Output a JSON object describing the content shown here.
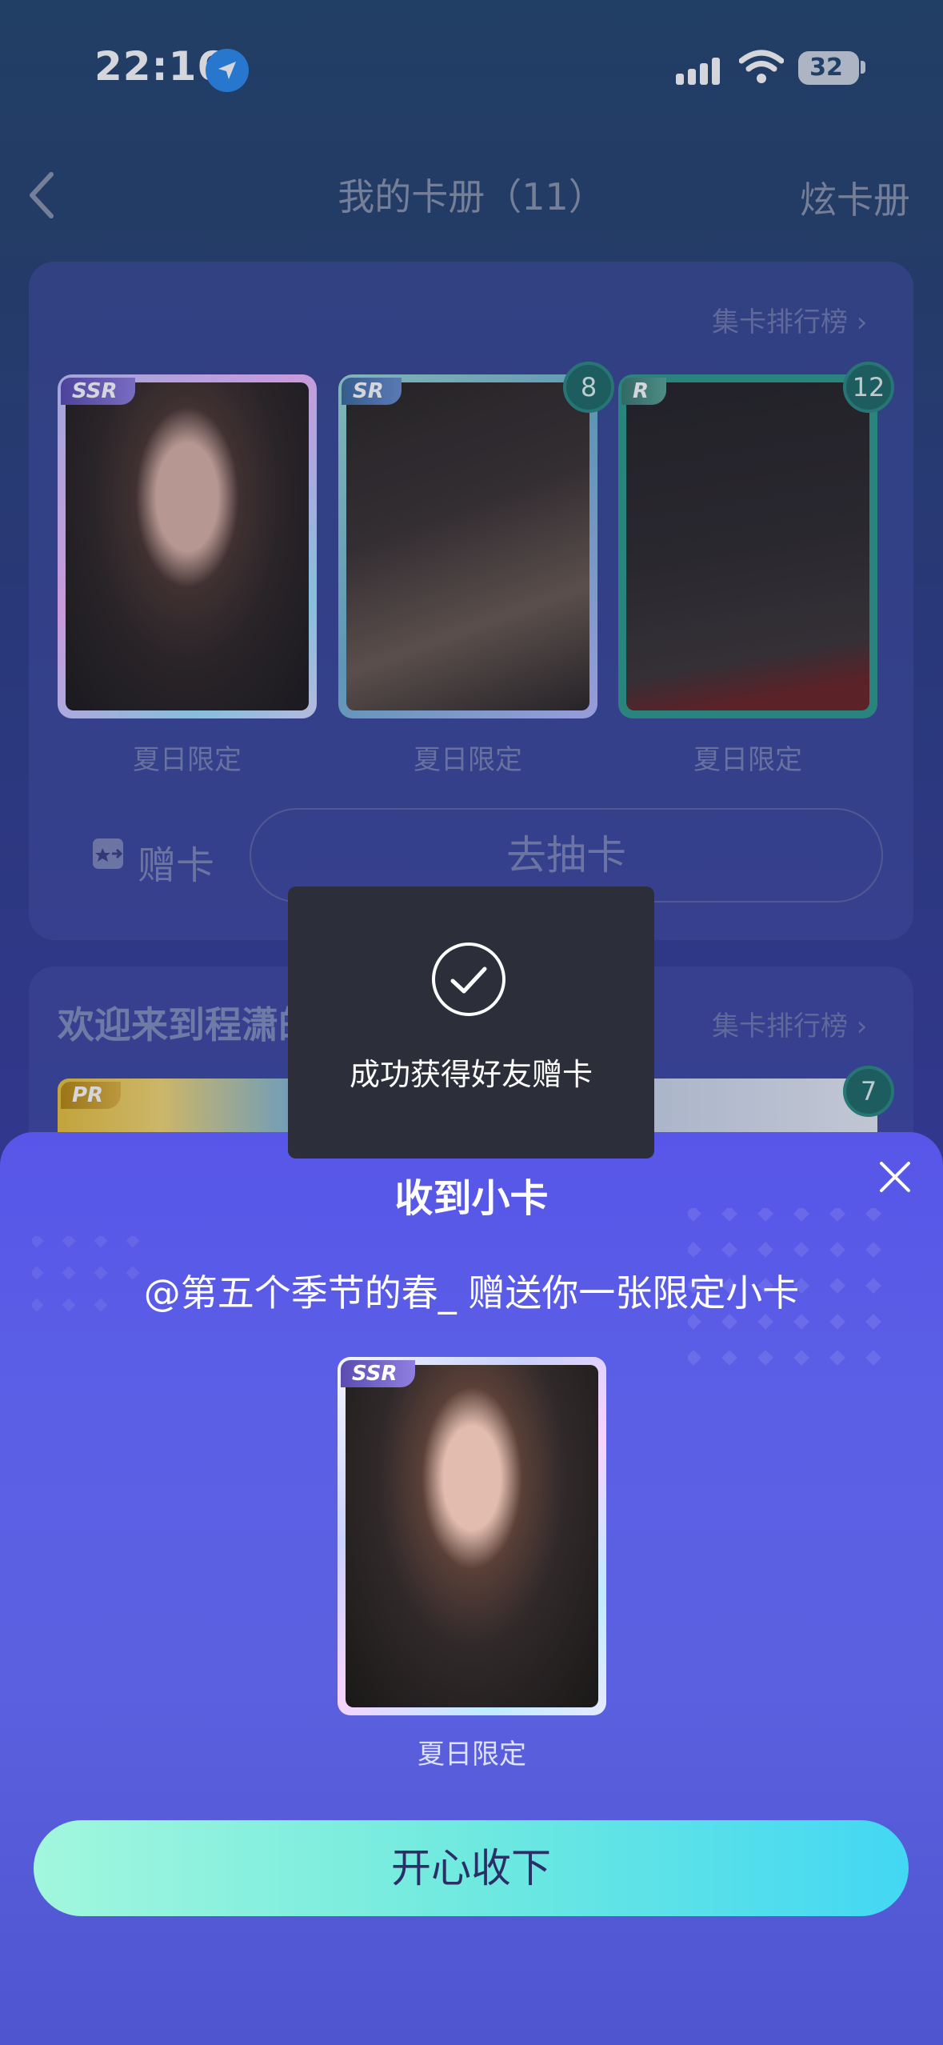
{
  "status_bar": {
    "time": "22:16",
    "battery": "32"
  },
  "header": {
    "title": "我的卡册（11）",
    "right_action": "炫卡册"
  },
  "album_1": {
    "rank_link": "集卡排行榜 ›",
    "cards": [
      {
        "rarity": "SSR",
        "caption": "夏日限定",
        "count": ""
      },
      {
        "rarity": "SR",
        "caption": "夏日限定",
        "count": "8"
      },
      {
        "rarity": "R",
        "caption": "夏日限定",
        "count": "12"
      }
    ],
    "gift_button": "赠卡",
    "draw_button": "去抽卡"
  },
  "album_2": {
    "title": "欢迎来到程潇的28岁(4/4)",
    "rank_link": "集卡排行榜 ›",
    "first_rarity": "PR",
    "count": "7"
  },
  "toast": {
    "message": "成功获得好友赠卡"
  },
  "sheet": {
    "title": "收到小卡",
    "message": "@第五个季节的春_ 赠送你一张限定小卡",
    "card_rarity": "SSR",
    "card_caption": "夏日限定",
    "accept_button": "开心收下"
  },
  "colors": {
    "accent_gradient_start": "#a2f7dd",
    "accent_gradient_end": "#43d7f4",
    "sheet_bg": "#5756e8",
    "toast_bg": "#2c2f3a"
  }
}
